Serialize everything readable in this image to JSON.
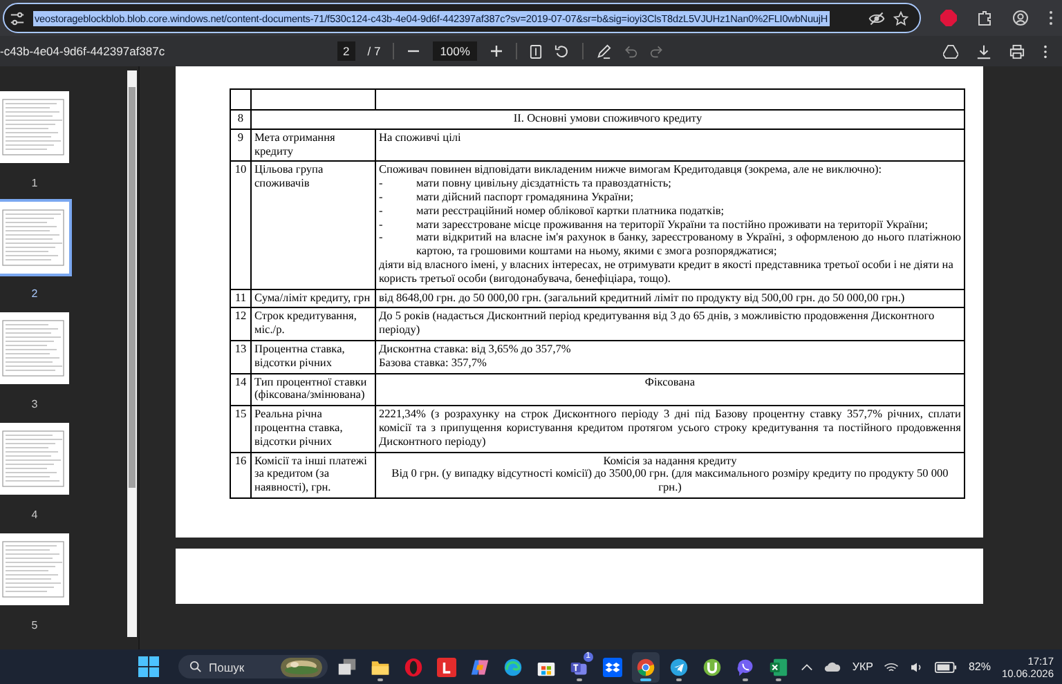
{
  "address_bar": {
    "url": "veostorageblockblob.blob.core.windows.net/content-documents-71/f530c124-c43b-4e04-9d6f-442397af387c?sv=2019-07-07&sr=b&sig=ioyi3ClsT8dzL5VJUHz1Nan0%2FLI0wbNuujH"
  },
  "pdf_toolbar": {
    "file_name": "-c43b-4e04-9d6f-442397af387c",
    "page_current": "2",
    "page_total": "/ 7",
    "zoom": "100%"
  },
  "thumbnails": [
    {
      "label": "1",
      "selected": false
    },
    {
      "label": "2",
      "selected": true
    },
    {
      "label": "3",
      "selected": false
    },
    {
      "label": "4",
      "selected": false
    },
    {
      "label": "5",
      "selected": false
    }
  ],
  "document": {
    "rows": [
      {
        "kind": "section",
        "number": "8",
        "title": "II. Основні умови споживчого кредиту"
      },
      {
        "kind": "item",
        "number": "9",
        "label": "Мета отримання кредиту",
        "content": [
          {
            "kind": "paragraph",
            "text": "На споживчі цілі"
          }
        ]
      },
      {
        "kind": "item",
        "number": "10",
        "label": "Цільова група споживачів",
        "content": [
          {
            "kind": "paragraph",
            "text": "Споживач повинен відповідати викладеним нижче вимогам Кредитодавця (зокрема, але не виключно):"
          },
          {
            "kind": "bullet",
            "marker": "-",
            "text": "мати повну цивільну дієздатність та правоздатність;"
          },
          {
            "kind": "bullet",
            "marker": "-",
            "text": "мати дійсний паспорт громадянина України;"
          },
          {
            "kind": "bullet",
            "marker": "-",
            "text": "мати реєстраційний номер облікової картки платника податків;"
          },
          {
            "kind": "bullet",
            "marker": "-",
            "text": "мати зареєстроване місце проживання на території України та постійно проживати на території України;"
          },
          {
            "kind": "bullet",
            "marker": "-",
            "text": "мати відкритий на власне ім'я рахунок в банку, зареєстрованому в Україні, з оформленою до нього платіжною картою, та грошовими коштами на ньому, якими є змога розпоряджатися;"
          },
          {
            "kind": "paragraph",
            "text": "діяти від власного імені, у власних інтересах, не отримувати кредит в якості представника третьої особи і не діяти на користь третьої особи (вигодонабувача, бенефіціара, тощо)."
          }
        ]
      },
      {
        "kind": "item",
        "number": "11",
        "label": "Сума/ліміт кредиту, грн",
        "content": [
          {
            "kind": "paragraph",
            "text": "від 8648,00 грн. до 50 000,00 грн. (загальний кредитний ліміт по продукту від 500,00 грн. до 50 000,00 грн.)"
          }
        ]
      },
      {
        "kind": "item",
        "number": "12",
        "label": "Строк кредитування, міс./р.",
        "content": [
          {
            "kind": "paragraph",
            "text": "До 5 років (надається Дисконтний період кредитування від 3 до 65 днів, з можливістю продовження Дисконтного періоду)"
          }
        ]
      },
      {
        "kind": "item",
        "number": "13",
        "label": "Процентна ставка, відсотки річних",
        "content": [
          {
            "kind": "paragraph",
            "text": "Дисконтна ставка: від 3,65% до 357,7%"
          },
          {
            "kind": "paragraph",
            "text": "Базова ставка: 357,7%"
          }
        ]
      },
      {
        "kind": "item",
        "number": "14",
        "label": "Тип процентної ставки (фіксована/змінювана)",
        "content": [
          {
            "kind": "centered",
            "text": "Фіксована"
          }
        ]
      },
      {
        "kind": "item",
        "number": "15",
        "label": "Реальна річна процентна ставка, відсотки річних",
        "content": [
          {
            "kind": "justified",
            "text": "2221,34% (з розрахунку на строк Дисконтного періоду 3 дні під Базову процентну ставку 357,7% річних, сплати комісії та з припущення користування кредитом протягом усього строку кредитування та постійного продовження Дисконтного періоду)"
          }
        ]
      },
      {
        "kind": "item",
        "number": "16",
        "label": "Комісії та інші платежі за кредитом (за наявності), грн.",
        "content": [
          {
            "kind": "centered",
            "text": "Комісія за надання кредиту"
          },
          {
            "kind": "centered",
            "text": "Від 0 грн. (у випадку відсутності комісії) до 3500,00 грн. (для максимального розміру кредиту по продукту 50 000 грн.)"
          }
        ]
      }
    ]
  },
  "taskbar": {
    "search_placeholder": "Пошук",
    "language": "УКР",
    "battery": "82%",
    "time": "17:17",
    "date": "10.06.2026",
    "apps": [
      {
        "kind": "taskview",
        "running": false,
        "selected": false
      },
      {
        "kind": "explorer",
        "running": true,
        "selected": false
      },
      {
        "kind": "opera",
        "running": false,
        "selected": false
      },
      {
        "kind": "lapp",
        "running": false,
        "selected": false
      },
      {
        "kind": "copilot",
        "running": false,
        "selected": false
      },
      {
        "kind": "edge",
        "running": false,
        "selected": false
      },
      {
        "kind": "store",
        "running": false,
        "selected": false
      },
      {
        "kind": "teams",
        "running": true,
        "selected": false,
        "badge": "1"
      },
      {
        "kind": "dropbox",
        "running": false,
        "selected": false
      },
      {
        "kind": "chrome",
        "running": true,
        "selected": true
      },
      {
        "kind": "telegram",
        "running": true,
        "selected": false
      },
      {
        "kind": "utorrent",
        "running": false,
        "selected": false
      },
      {
        "kind": "viber",
        "running": true,
        "selected": false
      },
      {
        "kind": "excel",
        "running": true,
        "selected": false
      }
    ]
  }
}
